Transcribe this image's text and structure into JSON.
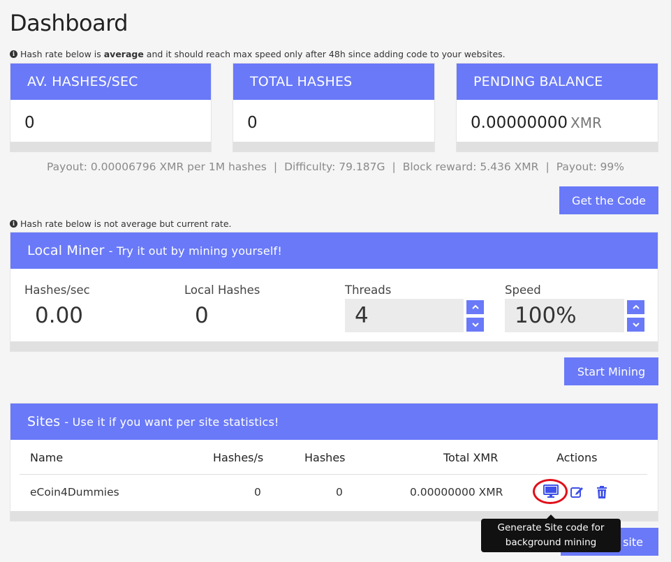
{
  "page": {
    "title": "Dashboard"
  },
  "notes": {
    "avg_pre": "Hash rate below is ",
    "avg_bold": "average",
    "avg_post": " and it should reach max speed only after 48h since adding code to your websites.",
    "current": "Hash rate below is not average but current rate."
  },
  "stats": [
    {
      "label": "AV. HASHES/SEC",
      "value": "0",
      "unit": ""
    },
    {
      "label": "TOTAL HASHES",
      "value": "0",
      "unit": ""
    },
    {
      "label": "PENDING BALANCE",
      "value": "0.00000000",
      "unit": "XMR"
    }
  ],
  "network": {
    "payout": "Payout: 0.00006796 XMR per 1M hashes",
    "difficulty": "Difficulty: 79.187G",
    "reward": "Block reward: 5.436 XMR",
    "payout_pct": "Payout: 99%",
    "separator": "|"
  },
  "buttons": {
    "get_code": "Get the Code",
    "start_mining": "Start Mining",
    "new_site": "new site"
  },
  "miner": {
    "title": "Local Miner",
    "subtitle": "- Try it out by mining yourself!",
    "hashes_label": "Hashes/sec",
    "hashes_value": "0.00",
    "local_label": "Local Hashes",
    "local_value": "0",
    "threads_label": "Threads",
    "threads_value": "4",
    "speed_label": "Speed",
    "speed_value": "100%"
  },
  "sites": {
    "title": "Sites",
    "subtitle": "- Use it if you want per site statistics!",
    "columns": [
      "Name",
      "Hashes/s",
      "Hashes",
      "Total XMR",
      "Actions"
    ],
    "rows": [
      {
        "name": "eCoin4Dummies",
        "hashes_s": "0",
        "hashes": "0",
        "total_xmr": "0.00000000 XMR"
      }
    ]
  },
  "tooltip": {
    "line1": "Generate Site code for",
    "line2": "background mining"
  },
  "colors": {
    "accent": "#6979f8",
    "highlight": "#e0101a",
    "icon": "#3f51e8"
  }
}
